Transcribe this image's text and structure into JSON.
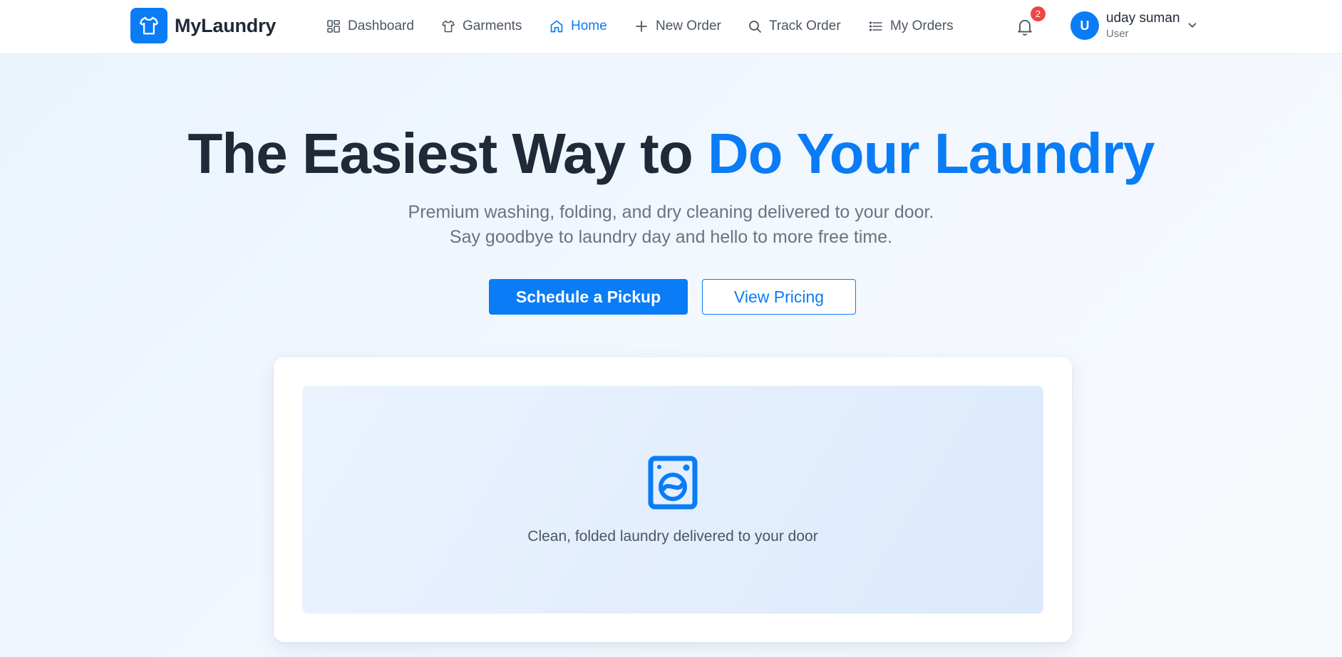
{
  "app": {
    "brand_name": "MyLaundry",
    "brand_icon": "tshirt-icon",
    "accent_color": "#0a7cf5"
  },
  "nav": {
    "items": [
      {
        "label": "Dashboard",
        "icon": "dashboard-grid-icon",
        "active": false
      },
      {
        "label": "Garments",
        "icon": "shirt-icon",
        "active": false
      },
      {
        "label": "Home",
        "icon": "home-icon",
        "active": true
      },
      {
        "label": "New Order",
        "icon": "plus-icon",
        "active": false
      },
      {
        "label": "Track Order",
        "icon": "search-icon",
        "active": false
      },
      {
        "label": "My Orders",
        "icon": "list-icon",
        "active": false
      }
    ],
    "notifications_count": "2",
    "user": {
      "initial": "U",
      "name": "uday suman",
      "role": "User"
    }
  },
  "hero": {
    "title_prefix": "The Easiest Way to ",
    "title_accent": "Do Your Laundry",
    "subtitle_line1": "Premium washing, folding, and dry cleaning delivered to your door.",
    "subtitle_line2": "Say goodbye to laundry day and hello to more free time.",
    "primary_button": "Schedule a Pickup",
    "secondary_button": "View Pricing"
  },
  "showcase": {
    "icon": "washing-machine-icon",
    "caption": "Clean, folded laundry delivered to your door"
  }
}
